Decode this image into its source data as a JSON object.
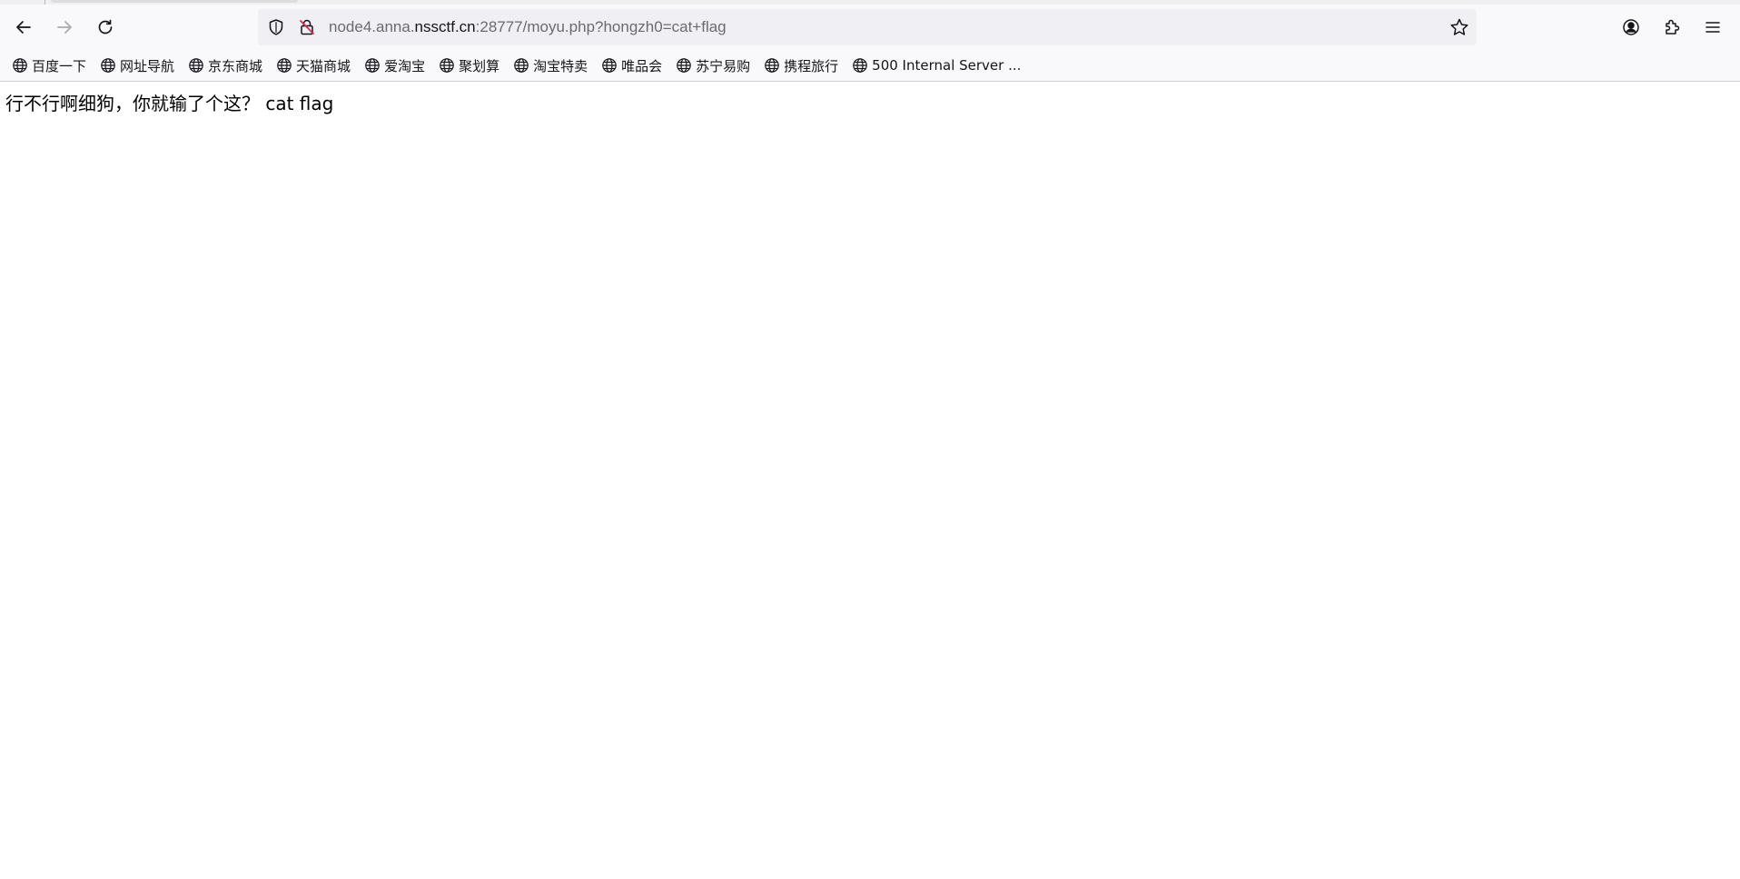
{
  "tabstrip": {},
  "navbar": {
    "url": {
      "prefix": "node4.anna.",
      "host": "nssctf.cn",
      "suffix": ":28777/moyu.php?hongzh0=cat+flag"
    }
  },
  "bookmarks": [
    {
      "label": "百度一下"
    },
    {
      "label": "网址导航"
    },
    {
      "label": "京东商城"
    },
    {
      "label": "天猫商城"
    },
    {
      "label": "爱淘宝"
    },
    {
      "label": "聚划算"
    },
    {
      "label": "淘宝特卖"
    },
    {
      "label": "唯品会"
    },
    {
      "label": "苏宁易购"
    },
    {
      "label": "携程旅行"
    },
    {
      "label": "500 Internal Server ..."
    }
  ],
  "page": {
    "message": "行不行啊细狗，你就输了个这？ cat flag"
  },
  "colors": {
    "toolbar_bg": "#f9f9fb",
    "urlbar_bg": "#f0f0f4",
    "text": "#15141a"
  }
}
